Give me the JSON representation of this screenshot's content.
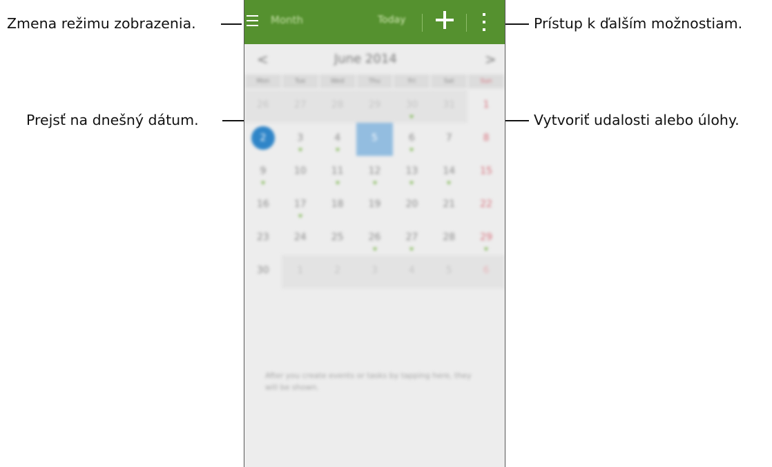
{
  "callouts": {
    "view_mode": "Zmena režimu zobrazenia.",
    "today": "Prejsť na dnešný dátum.",
    "more": "Prístup k ďalším možnostiam.",
    "create": "Vytvoriť udalosti alebo úlohy."
  },
  "actionbar": {
    "title": "Month",
    "today_label": "Today",
    "menu_icon": "hamburger-icon",
    "add_icon": "plus-icon",
    "more_icon": "more-vert-icon"
  },
  "calendar": {
    "prev": "<",
    "next": ">",
    "month_title": "June 2014",
    "weekdays": [
      "Mon",
      "Tue",
      "Wed",
      "Thu",
      "Fri",
      "Sat",
      "Sun"
    ],
    "weeks": [
      [
        {
          "d": "26",
          "other": true
        },
        {
          "d": "27",
          "other": true
        },
        {
          "d": "28",
          "other": true
        },
        {
          "d": "29",
          "other": true
        },
        {
          "d": "30",
          "other": true,
          "event": true
        },
        {
          "d": "31",
          "other": true
        },
        {
          "d": "1"
        }
      ],
      [
        {
          "d": "2",
          "today": true
        },
        {
          "d": "3",
          "event": true
        },
        {
          "d": "4",
          "event": true
        },
        {
          "d": "5",
          "selected": true
        },
        {
          "d": "6",
          "event": true
        },
        {
          "d": "7"
        },
        {
          "d": "8"
        }
      ],
      [
        {
          "d": "9",
          "event": true
        },
        {
          "d": "10"
        },
        {
          "d": "11",
          "event": true
        },
        {
          "d": "12",
          "event": true
        },
        {
          "d": "13",
          "event": true
        },
        {
          "d": "14",
          "event": true
        },
        {
          "d": "15"
        }
      ],
      [
        {
          "d": "16"
        },
        {
          "d": "17",
          "event": true
        },
        {
          "d": "18"
        },
        {
          "d": "19"
        },
        {
          "d": "20"
        },
        {
          "d": "21"
        },
        {
          "d": "22"
        }
      ],
      [
        {
          "d": "23"
        },
        {
          "d": "24"
        },
        {
          "d": "25"
        },
        {
          "d": "26",
          "event": true
        },
        {
          "d": "27",
          "event": true
        },
        {
          "d": "28"
        },
        {
          "d": "29",
          "event": true
        }
      ],
      [
        {
          "d": "30"
        },
        {
          "d": "1",
          "other": true
        },
        {
          "d": "2",
          "other": true
        },
        {
          "d": "3",
          "other": true
        },
        {
          "d": "4",
          "other": true
        },
        {
          "d": "5",
          "other": true
        },
        {
          "d": "6",
          "other": true
        }
      ]
    ],
    "empty_message": "After you create events or tasks by tapping here, they will be shown."
  },
  "colors": {
    "actionbar": "#55912f",
    "today_circle": "#2f85c8",
    "selected": "#93bde0",
    "sunday": "#d8707c",
    "event_marker": "#79b64a"
  }
}
